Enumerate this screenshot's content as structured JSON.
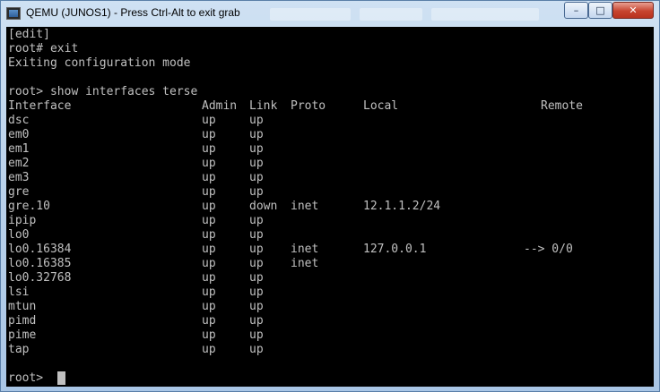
{
  "window": {
    "title": "QEMU (JUNOS1) - Press Ctrl-Alt to exit grab",
    "controls": {
      "minimize": "–",
      "maximize": "□",
      "close": "✕"
    }
  },
  "terminal": {
    "pre_lines": [
      "[edit]",
      "root# exit",
      "Exiting configuration mode",
      "",
      "root> show interfaces terse"
    ],
    "table": {
      "headers": {
        "interface": "Interface",
        "admin": "Admin",
        "link": "Link",
        "proto": "Proto",
        "local": "Local",
        "remote": "Remote"
      },
      "rows": [
        {
          "interface": "dsc",
          "admin": "up",
          "link": "up",
          "proto": "",
          "local": "",
          "remote": ""
        },
        {
          "interface": "em0",
          "admin": "up",
          "link": "up",
          "proto": "",
          "local": "",
          "remote": ""
        },
        {
          "interface": "em1",
          "admin": "up",
          "link": "up",
          "proto": "",
          "local": "",
          "remote": ""
        },
        {
          "interface": "em2",
          "admin": "up",
          "link": "up",
          "proto": "",
          "local": "",
          "remote": ""
        },
        {
          "interface": "em3",
          "admin": "up",
          "link": "up",
          "proto": "",
          "local": "",
          "remote": ""
        },
        {
          "interface": "gre",
          "admin": "up",
          "link": "up",
          "proto": "",
          "local": "",
          "remote": ""
        },
        {
          "interface": "gre.10",
          "admin": "up",
          "link": "down",
          "proto": "inet",
          "local": "12.1.1.2/24",
          "remote": ""
        },
        {
          "interface": "ipip",
          "admin": "up",
          "link": "up",
          "proto": "",
          "local": "",
          "remote": ""
        },
        {
          "interface": "lo0",
          "admin": "up",
          "link": "up",
          "proto": "",
          "local": "",
          "remote": ""
        },
        {
          "interface": "lo0.16384",
          "admin": "up",
          "link": "up",
          "proto": "inet",
          "local": "127.0.0.1",
          "remote": "--> 0/0"
        },
        {
          "interface": "lo0.16385",
          "admin": "up",
          "link": "up",
          "proto": "inet",
          "local": "",
          "remote": ""
        },
        {
          "interface": "lo0.32768",
          "admin": "up",
          "link": "up",
          "proto": "",
          "local": "",
          "remote": ""
        },
        {
          "interface": "lsi",
          "admin": "up",
          "link": "up",
          "proto": "",
          "local": "",
          "remote": ""
        },
        {
          "interface": "mtun",
          "admin": "up",
          "link": "up",
          "proto": "",
          "local": "",
          "remote": ""
        },
        {
          "interface": "pimd",
          "admin": "up",
          "link": "up",
          "proto": "",
          "local": "",
          "remote": ""
        },
        {
          "interface": "pime",
          "admin": "up",
          "link": "up",
          "proto": "",
          "local": "",
          "remote": ""
        },
        {
          "interface": "tap",
          "admin": "up",
          "link": "up",
          "proto": "",
          "local": "",
          "remote": ""
        }
      ]
    },
    "prompt": "root> "
  }
}
